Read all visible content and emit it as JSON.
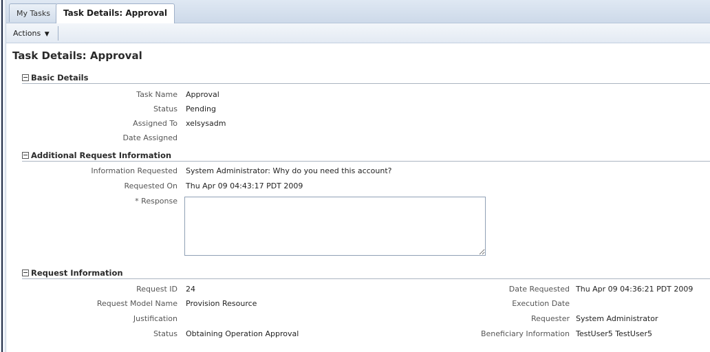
{
  "tabs": [
    {
      "label": "My Tasks"
    },
    {
      "label": "Task Details: Approval"
    }
  ],
  "toolbar": {
    "actions_label": "Actions"
  },
  "page_title": "Task Details: Approval",
  "sections": {
    "basic": {
      "title": "Basic Details",
      "fields": [
        {
          "label": "Task Name",
          "value": "Approval"
        },
        {
          "label": "Status",
          "value": "Pending"
        },
        {
          "label": "Assigned To",
          "value": "xelsysadm"
        },
        {
          "label": "Date Assigned",
          "value": ""
        }
      ]
    },
    "additional": {
      "title": "Additional Request Information",
      "fields": [
        {
          "label": "Information Requested",
          "value": "System Administrator: Why do you need this account?"
        },
        {
          "label": "Requested On",
          "value": "Thu Apr 09 04:43:17 PDT 2009"
        }
      ],
      "response_label": "* Response",
      "response_value": ""
    },
    "request": {
      "title": "Request Information",
      "left": [
        {
          "label": "Request ID",
          "value": "24"
        },
        {
          "label": "Request Model Name",
          "value": "Provision Resource"
        },
        {
          "label": "Justification",
          "value": ""
        },
        {
          "label": "Status",
          "value": "Obtaining Operation Approval"
        }
      ],
      "right": [
        {
          "label": "Date Requested",
          "value": "Thu Apr 09 04:36:21 PDT 2009"
        },
        {
          "label": "Execution Date",
          "value": ""
        },
        {
          "label": "Requester",
          "value": "System Administrator"
        },
        {
          "label": "Beneficiary Information",
          "value": "TestUser5 TestUser5"
        }
      ]
    }
  }
}
